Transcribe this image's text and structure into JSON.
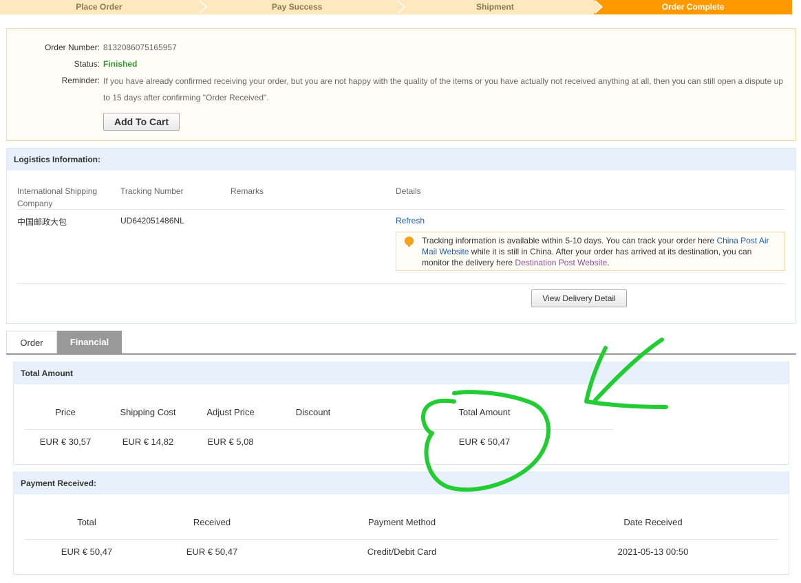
{
  "progress": {
    "steps": [
      {
        "label": "Place Order"
      },
      {
        "label": "Pay Success"
      },
      {
        "label": "Shipment"
      },
      {
        "label": "Order Complete"
      }
    ],
    "current": "Order Complete"
  },
  "order": {
    "number_label": "Order Number:",
    "number": "8132086075165957",
    "status_label": "Status:",
    "status": "Finished",
    "reminder_label": "Reminder:",
    "reminder": "If you have already confirmed receiving your order, but you are not happy with the quality of the items or you have actually not received anything at all, then you can still open a dispute up to 15 days after confirming \"Order Received\".",
    "add_to_cart": "Add To Cart"
  },
  "logistics": {
    "title": "Logistics Information:",
    "columns": {
      "company": "International Shipping Company",
      "tracking": "Tracking Number",
      "remarks": "Remarks",
      "details": "Details"
    },
    "row": {
      "company": "中国邮政大包",
      "tracking": "UD642051486NL",
      "remarks": "",
      "refresh": "Refresh"
    },
    "tip": {
      "text1": "Tracking information is available within 5-10 days. You can track your order here ",
      "link1": "China Post Air Mail Website",
      "text2": " while it is still in China. After your order has arrived at its destination, you can monitor the delivery here ",
      "link2": "Destination Post Website",
      "text3": "."
    },
    "view_delivery": "View Delivery Detail"
  },
  "tabs": [
    {
      "label": "Order",
      "active": false
    },
    {
      "label": "Financial",
      "active": true
    }
  ],
  "total_amount": {
    "title": "Total Amount",
    "headers": [
      "Price",
      "Shipping Cost",
      "Adjust Price",
      "Discount",
      "Total Amount"
    ],
    "values": [
      "EUR € 30,57",
      "EUR € 14,82",
      "EUR € 5,08",
      "",
      "EUR € 50,47"
    ]
  },
  "payment": {
    "title": "Payment Received:",
    "headers": [
      "Total",
      "Received",
      "Payment Method",
      "Date Received"
    ],
    "values": [
      "EUR € 50,47",
      "EUR € 50,47",
      "Credit/Debit Card",
      "2021-05-13 00:50"
    ]
  },
  "colors": {
    "accent": "#ff9900",
    "step_bg": "#fde9bd",
    "status_green": "#2e9a2e",
    "link": "#1a5fb4",
    "annotation": "#22cc33"
  }
}
